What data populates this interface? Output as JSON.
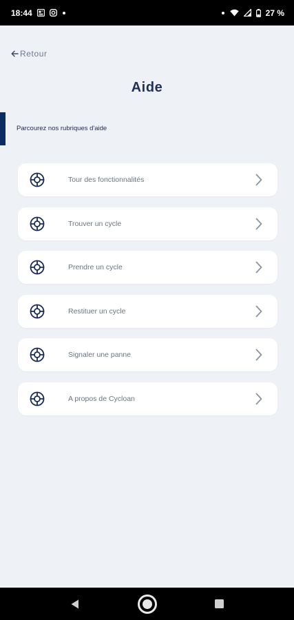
{
  "status_bar": {
    "time": "18:44",
    "battery_percent": "27 %",
    "left_icons": [
      "newspaper-icon",
      "instagram-icon",
      "dot-icon"
    ],
    "right_icons": [
      "dot-icon",
      "wifi-icon",
      "signal-icon",
      "battery-icon"
    ]
  },
  "header": {
    "back_label": "Retour",
    "title": "Aide"
  },
  "section": {
    "subtitle": "Parcourez nos rubriques d'aide"
  },
  "menu": {
    "icon": "lifebuoy-icon",
    "items": [
      {
        "label": "Tour des fonctionnalités"
      },
      {
        "label": "Trouver un cycle"
      },
      {
        "label": "Prendre un cycle"
      },
      {
        "label": "Restituer un cycle"
      },
      {
        "label": "Signaler une panne"
      },
      {
        "label": "A propos de Cycloan"
      }
    ]
  },
  "nav_bar": {
    "buttons": [
      "back-triangle-icon",
      "home-circle-icon",
      "recents-square-icon"
    ]
  },
  "colors": {
    "background": "#eef1f6",
    "title": "#21305a",
    "accent": "#0d2b63",
    "card": "#ffffff",
    "label": "#6a7486"
  }
}
